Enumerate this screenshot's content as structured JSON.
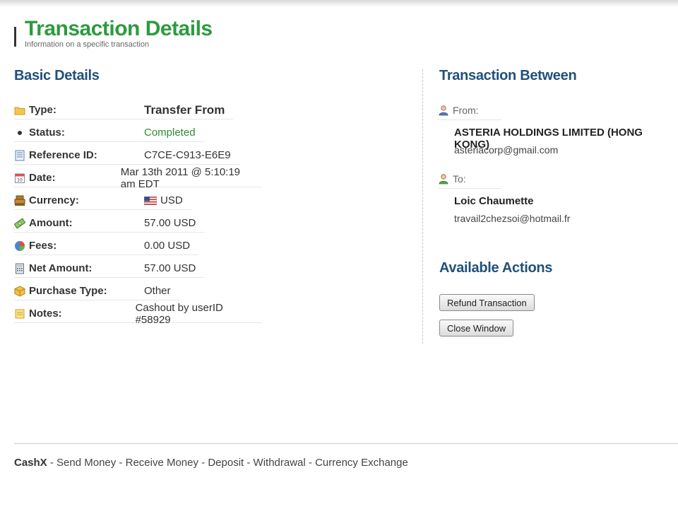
{
  "header": {
    "title": "Transaction Details",
    "subtitle": "Information on a specific transaction"
  },
  "basic_details": {
    "title": "Basic Details",
    "rows": [
      {
        "label": "Type:",
        "value": "Transfer From",
        "icon": "folder-icon"
      },
      {
        "label": "Status:",
        "value": "Completed",
        "icon": "bullet-icon"
      },
      {
        "label": "Reference ID:",
        "value": "C7CE-C913-E6E9",
        "icon": "document-icon"
      },
      {
        "label": "Date:",
        "value": "Mar 13th 2011 @ 5:10:19 am EDT",
        "icon": "calendar-icon"
      },
      {
        "label": "Currency:",
        "value": "USD",
        "icon": "cash-register-icon"
      },
      {
        "label": "Amount:",
        "value": "57.00 USD",
        "icon": "money-icon"
      },
      {
        "label": "Fees:",
        "value": "0.00 USD",
        "icon": "pie-chart-icon"
      },
      {
        "label": "Net Amount:",
        "value": "57.00 USD",
        "icon": "calculator-icon"
      },
      {
        "label": "Purchase Type:",
        "value": "Other",
        "icon": "package-icon"
      },
      {
        "label": "Notes:",
        "value": "Cashout by userID #58929",
        "icon": "note-icon"
      }
    ]
  },
  "transaction_between": {
    "title": "Transaction Between",
    "from": {
      "label": "From:",
      "name": "ASTERIA HOLDINGS LIMITED (HONG KONG)",
      "email": "asteriacorp@gmail.com"
    },
    "to": {
      "label": "To:",
      "name": "Loic Chaumette",
      "email": "travail2chezsoi@hotmail.fr"
    }
  },
  "actions": {
    "title": "Available Actions",
    "refund_label": "Refund Transaction",
    "close_label": "Close Window"
  },
  "footer": {
    "brand": "CashX",
    "separator": " - ",
    "links": [
      "Send Money",
      "Receive Money",
      "Deposit",
      "Withdrawal",
      "Currency Exchange"
    ]
  },
  "colors": {
    "title_green": "#2b9b3f",
    "section_blue": "#21507a",
    "status_green": "#2e8b2e"
  }
}
